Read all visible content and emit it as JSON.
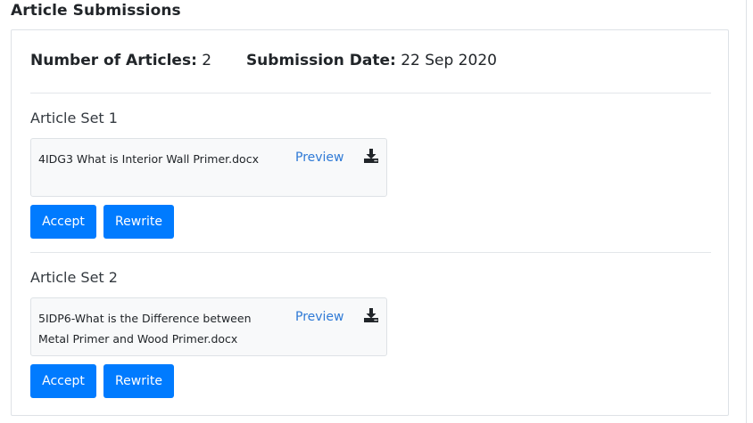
{
  "page": {
    "title": "Article Submissions"
  },
  "summary": {
    "articles_label": "Number of Articles:",
    "articles_value": "2",
    "date_label": "Submission Date:",
    "date_value": "22 Sep 2020"
  },
  "sets": [
    {
      "title": "Article Set 1",
      "file_name": "4IDG3 What is Interior Wall Primer.docx",
      "preview_label": "Preview",
      "download_icon": "download-icon",
      "accept_label": "Accept",
      "rewrite_label": "Rewrite"
    },
    {
      "title": "Article Set 2",
      "file_name": "5IDP6-What is the Difference between Metal Primer and Wood Primer.docx",
      "preview_label": "Preview",
      "download_icon": "download-icon",
      "accept_label": "Accept",
      "rewrite_label": "Rewrite"
    }
  ],
  "colors": {
    "primary": "#007bff",
    "link": "#2f7ad6",
    "card_bg": "#f8f9fa",
    "border": "#dee2e6"
  }
}
